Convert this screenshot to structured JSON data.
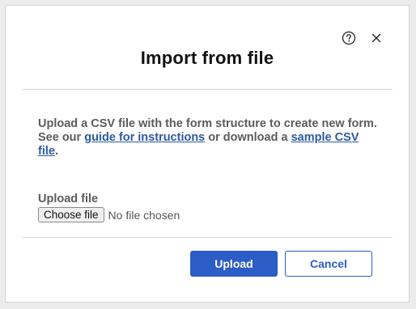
{
  "dialog": {
    "title": "Import from file",
    "description": {
      "part1": "Upload a CSV file with the form structure to create new form. See our ",
      "guide_link": "guide for instructions",
      "part2": " or download a ",
      "sample_link": "sample CSV file",
      "part3": "."
    },
    "upload": {
      "label": "Upload file",
      "choose_button": "Choose file",
      "status": "No file chosen"
    },
    "buttons": {
      "upload": "Upload",
      "cancel": "Cancel"
    },
    "icons": {
      "help": "help-icon",
      "close": "close-icon"
    },
    "colors": {
      "accent": "#2c5cc5",
      "link": "#2c5aa0",
      "title": "#111111",
      "text": "#5b5b5b"
    }
  }
}
